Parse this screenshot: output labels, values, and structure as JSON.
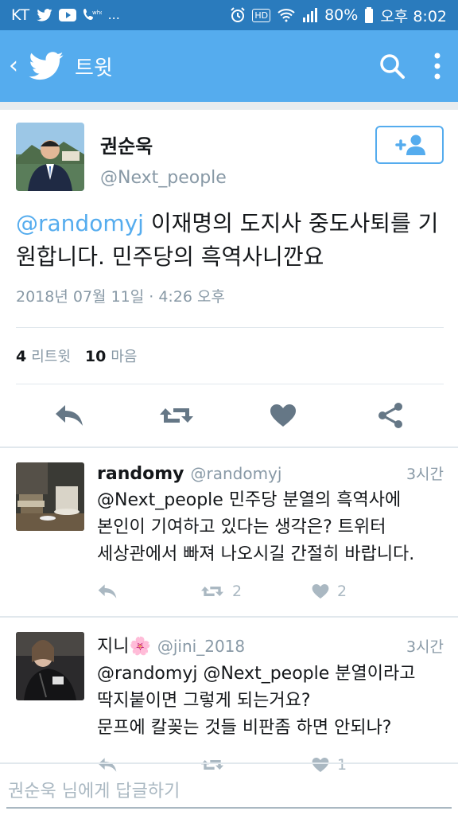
{
  "status_bar": {
    "carrier": "KT",
    "more": "...",
    "battery": "80%",
    "time": "오후 8:02",
    "hd": "HD"
  },
  "app_bar": {
    "title": "트윗"
  },
  "main_tweet": {
    "display_name": "권순욱",
    "handle": "@Next_people",
    "mention": "@randomyj",
    "text": " 이재명의 도지사 중도사퇴를 기원합니다. 민주당의 흑역사니깐요",
    "timestamp": "2018년 07월 11일 · 4:26 오후",
    "retweets_count": "4",
    "retweets_label": "리트윗",
    "likes_count": "10",
    "likes_label": "마음"
  },
  "replies": [
    {
      "name": "randomy",
      "handle": "@randomyj",
      "time": "3시간",
      "text_line1": "@Next_people 민주당 분열의 흑역사에",
      "text_line2": "본인이 기여하고 있다는 생각은? 트위터",
      "text_line3": "세상관에서 빠져 나오시길 간절히 바랍니다.",
      "retweets": "2",
      "likes": "2"
    },
    {
      "name": "지니🌸",
      "handle": "@jini_2018",
      "time": "3시간",
      "text_line1": "@randomyj @Next_people 분열이라고",
      "text_line2": "딱지붙이면 그렇게 되는거요?",
      "text_line3": "문프에 칼꽂는 것들 비판좀 하면 안되나?",
      "retweets": "",
      "likes": "1"
    }
  ],
  "composer": {
    "placeholder": "권순욱 님에게 답글하기"
  },
  "colors": {
    "status_bar": "#2a7bbd",
    "app_bar": "#55acee",
    "accent": "#55acee",
    "muted": "#8899a6"
  }
}
